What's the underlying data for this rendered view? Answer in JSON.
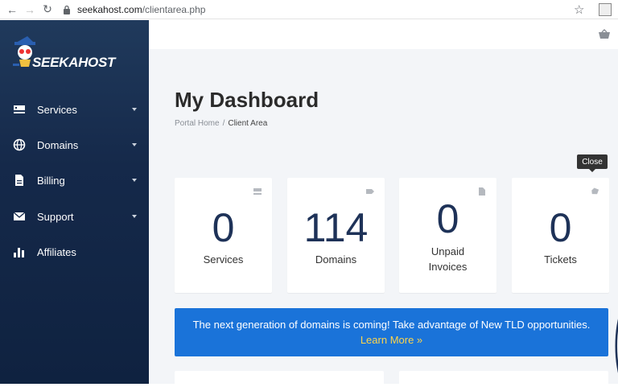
{
  "browser": {
    "url_host": "seekahost.com",
    "url_path": "/clientarea.php"
  },
  "brand": {
    "name": "SEEKAHOST"
  },
  "sidebar": {
    "items": [
      {
        "label": "Services",
        "icon": "server-icon",
        "has_caret": true
      },
      {
        "label": "Domains",
        "icon": "globe-icon",
        "has_caret": true
      },
      {
        "label": "Billing",
        "icon": "document-icon",
        "has_caret": true
      },
      {
        "label": "Support",
        "icon": "envelope-icon",
        "has_caret": true
      },
      {
        "label": "Affiliates",
        "icon": "bar-chart-icon",
        "has_caret": false
      }
    ]
  },
  "page": {
    "title": "My Dashboard",
    "breadcrumb": {
      "home": "Portal Home",
      "separator": "/",
      "current": "Client Area"
    }
  },
  "tooltip": {
    "text": "Close"
  },
  "stats": [
    {
      "value": "0",
      "label": "Services",
      "icon": "server-icon"
    },
    {
      "value": "114",
      "label": "Domains",
      "icon": "tag-icon"
    },
    {
      "value": "0",
      "label_line1": "Unpaid",
      "label_line2": "Invoices",
      "icon": "document-icon"
    },
    {
      "value": "0",
      "label": "Tickets",
      "icon": "ticket-icon"
    }
  ],
  "banner": {
    "text": "The next generation of domains is coming! Take advantage of New TLD opportunities.",
    "link": "Learn More »"
  },
  "colors": {
    "sidebar": "#15294a",
    "accent": "#1a73d9",
    "stat_number": "#1e3258",
    "link_yellow": "#ffd54a"
  }
}
